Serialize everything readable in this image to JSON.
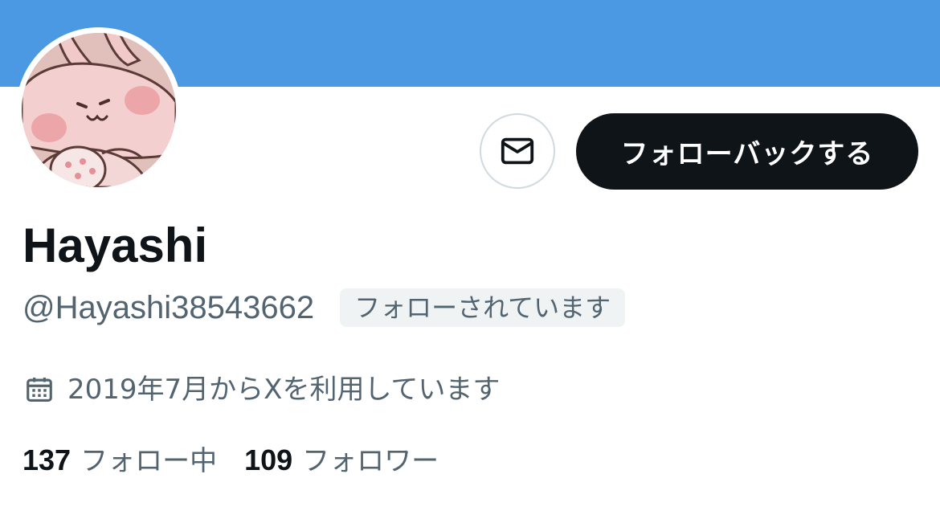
{
  "profile": {
    "display_name": "Hayashi",
    "handle": "@Hayashi38543662",
    "follows_you_badge": "フォローされています",
    "joined": "2019年7月からXを利用しています"
  },
  "actions": {
    "follow_back_label": "フォローバックする"
  },
  "stats": {
    "following_count": "137",
    "following_label": "フォロー中",
    "followers_count": "109",
    "followers_label": "フォロワー"
  },
  "icons": {
    "message": "mail-icon",
    "joined": "calendar-icon"
  },
  "colors": {
    "banner": "#4b99e3",
    "primary_text": "#0f1419",
    "secondary_text": "#536471",
    "button_bg": "#0f1419",
    "badge_bg": "#eff3f4"
  }
}
